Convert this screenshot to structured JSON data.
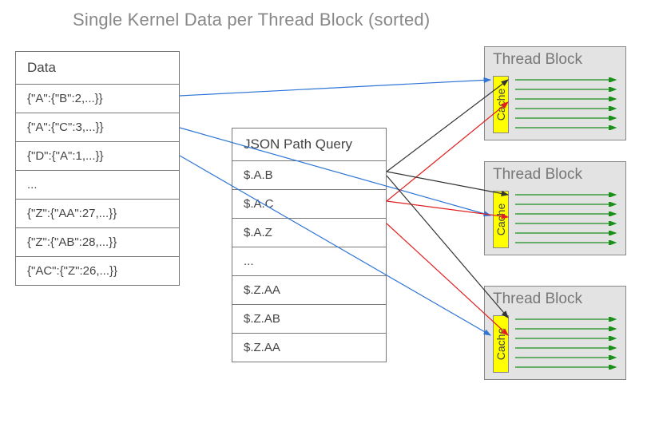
{
  "title": "Single Kernel Data per Thread Block (sorted)",
  "data_table": {
    "header": "Data",
    "rows": [
      "{\"A\":{\"B\":2,...}}",
      "{\"A\":{\"C\":3,...}}",
      "{\"D\":{\"A\":1,...}}",
      "...",
      "{\"Z\":{\"AA\":27,...}}",
      "{\"Z\":{\"AB\":28,...}}",
      "{\"AC\":{\"Z\":26,...}}"
    ]
  },
  "query_table": {
    "header": "JSON Path Query",
    "rows": [
      "$.A.B",
      "$.A.C",
      "$.A.Z",
      "...",
      "$.Z.AA",
      "$.Z.AB",
      "$.Z.AA"
    ]
  },
  "thread_blocks": {
    "label": "Thread Block",
    "cache_label": "Cache",
    "count": 3,
    "threads_per_block": 6
  },
  "colors": {
    "blue_line": "#2e75d6",
    "red_line": "#e02020",
    "dark_line": "#333333",
    "green_line": "#1a8f1a",
    "cache_bg": "#ffff00"
  }
}
